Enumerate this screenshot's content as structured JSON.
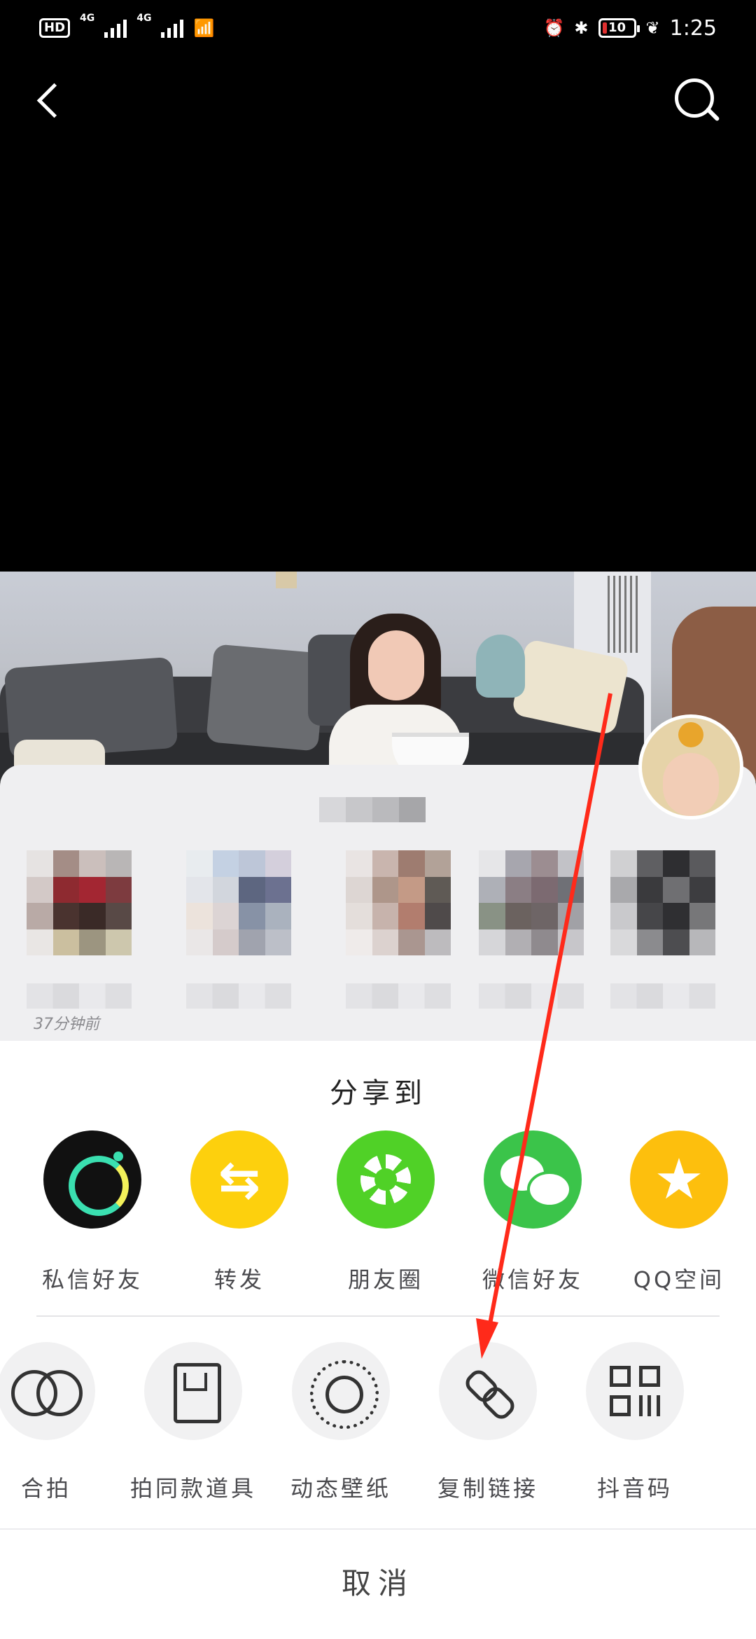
{
  "status_bar": {
    "hd": "HD",
    "network_1": "4G",
    "network_2": "4G",
    "battery_level": "10",
    "time": "1:25"
  },
  "icons": {
    "back": "back-arrow-icon",
    "search": "search-icon"
  },
  "friends_panel": {
    "time_caption": "37分钟前"
  },
  "share_sheet": {
    "title": "分享到",
    "targets": [
      {
        "label": "私信好友",
        "icon": "direct-message-icon",
        "color": "#111111"
      },
      {
        "label": "转发",
        "icon": "forward-icon",
        "color": "#fdd00d"
      },
      {
        "label": "朋友圈",
        "icon": "moments-icon",
        "color": "#50d127"
      },
      {
        "label": "微信好友",
        "icon": "wechat-icon",
        "color": "#3bc44a"
      },
      {
        "label": "QQ空间",
        "icon": "qzone-icon",
        "color": "#fdbf0d"
      }
    ],
    "actions": [
      {
        "label": "合拍",
        "icon": "duet-icon"
      },
      {
        "label": "拍同款道具",
        "icon": "prop-icon"
      },
      {
        "label": "动态壁纸",
        "icon": "live-wallpaper-icon"
      },
      {
        "label": "复制链接",
        "icon": "link-icon"
      },
      {
        "label": "抖音码",
        "icon": "qr-code-icon"
      }
    ],
    "cancel_label": "取消"
  },
  "annotation": {
    "color": "#ff2a1a"
  }
}
